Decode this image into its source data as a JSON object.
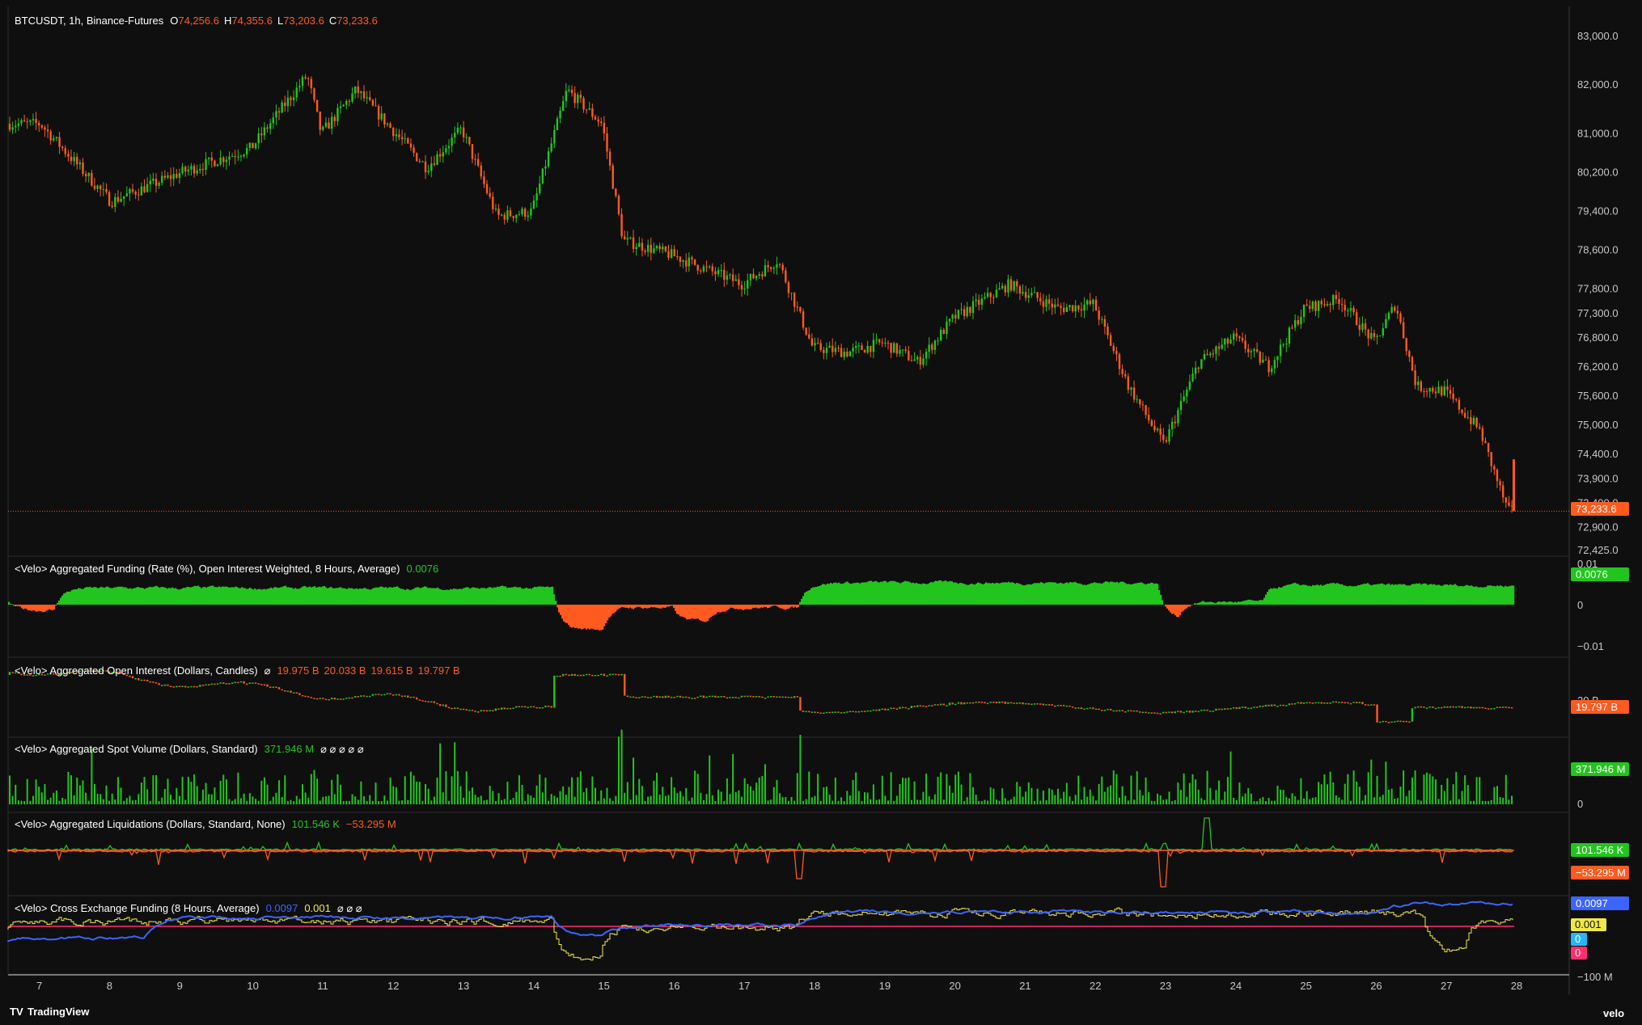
{
  "main": {
    "symbol": "BTCUSDT, 1h, Binance-Futures",
    "o_label": "O",
    "o_value": "74,256.6",
    "h_label": "H",
    "h_value": "74,355.6",
    "l_label": "L",
    "l_value": "73,203.6",
    "c_label": "C",
    "c_value": "73,233.6",
    "last_price": "73,233.6"
  },
  "funding": {
    "title": "<Velo> Aggregated Funding (Rate (%), Open Interest Weighted, 8 Hours, Average)",
    "value": "0.0076",
    "badge": "0.0076",
    "axis": [
      "0.01",
      "0",
      "−0.01"
    ]
  },
  "oi": {
    "title": "<Velo> Aggregated Open Interest (Dollars, Candles)",
    "symbol": "⌀",
    "o": "19.975 B",
    "h": "20.033 B",
    "l": "19.615 B",
    "c": "19.797 B",
    "axis_partial": "20 B",
    "badge": "19.797 B"
  },
  "spot": {
    "title": "<Velo> Aggregated Spot Volume (Dollars, Standard)",
    "value": "371.946 M",
    "extras": "⌀ ⌀ ⌀ ⌀ ⌀",
    "badge": "371.946 M",
    "axis": [
      "0"
    ]
  },
  "liq": {
    "title": "<Velo> Aggregated Liquidations (Dollars, Standard, None)",
    "value_pos": "101.546 K",
    "value_neg": "−53.295 M",
    "badge_pos": "101.546 K",
    "badge_neg": "−53.295 M"
  },
  "xfund": {
    "title": "<Velo> Cross Exchange Funding (8 Hours, Average)",
    "v1": "0.0097",
    "v2": "0.001",
    "extras": "⌀ ⌀ ⌀",
    "badges": [
      "0.0097",
      "0.001",
      "0",
      "0"
    ],
    "axis_partial": "−100 M"
  },
  "price_axis": [
    "83,000.0",
    "82,000.0",
    "81,000.0",
    "80,200.0",
    "79,400.0",
    "78,600.0",
    "77,800.0",
    "77,300.0",
    "76,800.0",
    "76,200.0",
    "75,600.0",
    "75,000.0",
    "74,400.0",
    "73,900.0",
    "73,400.0",
    "72,900.0",
    "72,425.0"
  ],
  "time_axis": [
    "7",
    "8",
    "9",
    "10",
    "11",
    "12",
    "13",
    "14",
    "15",
    "16",
    "17",
    "18",
    "19",
    "20",
    "21",
    "22",
    "23",
    "24",
    "25",
    "26",
    "27",
    "28"
  ],
  "footer": {
    "logo": "TradingView",
    "brand": "velo"
  },
  "colors": {
    "up": "#22c51e",
    "down": "#ff5a1f",
    "bg": "#0f0f0f",
    "blue": "#3c64ff",
    "yellow": "#f0e84a",
    "pink": "#ff2e6e",
    "cyan": "#29b6f6"
  },
  "chart_data": {
    "type": "candlestick",
    "symbol": "BTCUSDT",
    "interval": "1h",
    "x_ticks": [
      "7",
      "8",
      "9",
      "10",
      "11",
      "12",
      "13",
      "14",
      "15",
      "16",
      "17",
      "18",
      "19",
      "20",
      "21",
      "22",
      "23",
      "24",
      "25",
      "26",
      "27",
      "28"
    ],
    "ylim": [
      72425,
      83000
    ],
    "approx_close_path": [
      {
        "x": "7",
        "y": 81200
      },
      {
        "x": "8",
        "y": 79600
      },
      {
        "x": "9",
        "y": 80200
      },
      {
        "x": "10",
        "y": 80700
      },
      {
        "x": "10.8",
        "y": 82200
      },
      {
        "x": "11",
        "y": 81000
      },
      {
        "x": "11.5",
        "y": 81900
      },
      {
        "x": "12",
        "y": 81100
      },
      {
        "x": "12.5",
        "y": 80300
      },
      {
        "x": "13",
        "y": 81100
      },
      {
        "x": "13.5",
        "y": 79300
      },
      {
        "x": "14",
        "y": 79400
      },
      {
        "x": "14.5",
        "y": 81900
      },
      {
        "x": "15",
        "y": 81200
      },
      {
        "x": "15.3",
        "y": 78800
      },
      {
        "x": "16",
        "y": 78500
      },
      {
        "x": "16.5",
        "y": 78200
      },
      {
        "x": "17",
        "y": 77900
      },
      {
        "x": "17.5",
        "y": 78400
      },
      {
        "x": "18",
        "y": 76600
      },
      {
        "x": "18.5",
        "y": 76500
      },
      {
        "x": "19",
        "y": 76700
      },
      {
        "x": "19.5",
        "y": 76300
      },
      {
        "x": "20",
        "y": 77200
      },
      {
        "x": "20.8",
        "y": 77900
      },
      {
        "x": "21.5",
        "y": 77400
      },
      {
        "x": "22",
        "y": 77500
      },
      {
        "x": "22.5",
        "y": 75800
      },
      {
        "x": "23",
        "y": 74600
      },
      {
        "x": "23.5",
        "y": 76300
      },
      {
        "x": "24",
        "y": 76800
      },
      {
        "x": "24.5",
        "y": 76200
      },
      {
        "x": "25",
        "y": 77400
      },
      {
        "x": "25.5",
        "y": 77600
      },
      {
        "x": "26",
        "y": 76700
      },
      {
        "x": "26.3",
        "y": 77500
      },
      {
        "x": "26.6",
        "y": 75800
      },
      {
        "x": "27",
        "y": 75700
      },
      {
        "x": "27.5",
        "y": 74900
      },
      {
        "x": "27.9",
        "y": 73233.6
      }
    ],
    "last": {
      "open": 74256.6,
      "high": 74355.6,
      "low": 73203.6,
      "close": 73233.6
    }
  }
}
